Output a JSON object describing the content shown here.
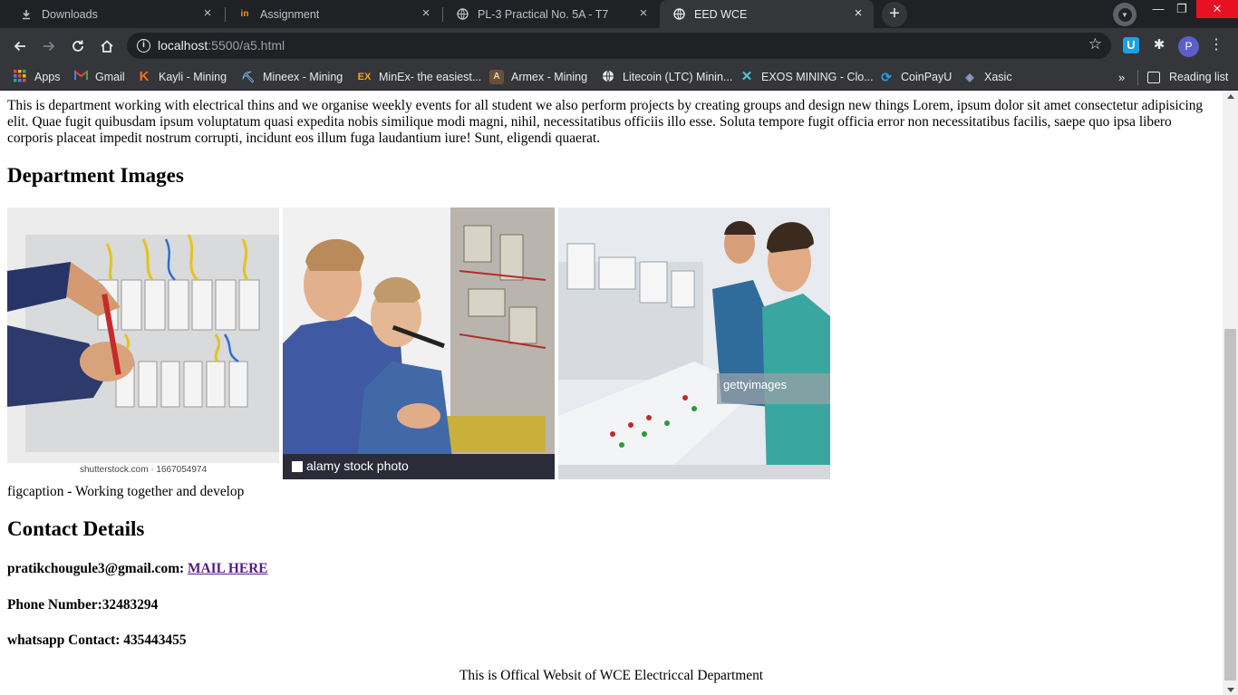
{
  "browser": {
    "tabs": [
      {
        "label": "Downloads",
        "icon": "download-icon"
      },
      {
        "label": "Assignment",
        "icon": "in-logo-icon"
      },
      {
        "label": "PL-3 Practical No. 5A - T7",
        "icon": "globe-icon"
      },
      {
        "label": "EED WCE",
        "icon": "globe-icon",
        "active": true
      }
    ],
    "new_tab_label": "+",
    "window_controls": {
      "minimize": "—",
      "restore": "❐",
      "close": "✕"
    },
    "address": {
      "host": "localhost",
      "path": ":5500/a5.html"
    },
    "profile_initial": "P",
    "extension_label": "U",
    "bookmarks": [
      {
        "label": "Apps",
        "icon": "apps-grid-icon"
      },
      {
        "label": "Gmail",
        "icon": "gmail-icon"
      },
      {
        "label": "Kayli - Mining",
        "icon": "k-logo-icon"
      },
      {
        "label": "Mineex - Mining",
        "icon": "mineex-icon"
      },
      {
        "label": "MinEx- the easiest...",
        "icon": "ex-logo-icon"
      },
      {
        "label": "Armex - Mining",
        "icon": "armex-icon"
      },
      {
        "label": "Litecoin (LTC) Minin...",
        "icon": "globe-icon"
      },
      {
        "label": "EXOS MINING - Clo...",
        "icon": "x-logo-icon"
      },
      {
        "label": "CoinPayU",
        "icon": "coinpayu-icon"
      },
      {
        "label": "Xasic",
        "icon": "xasic-icon"
      }
    ],
    "more_bookmarks": "»",
    "reading_list": "Reading list"
  },
  "page": {
    "intro": "This is department working with electrical thins and we organise weekly events for all student we also perform projects by creating groups and design new things Lorem, ipsum dolor sit amet consectetur adipisicing elit. Quae fugit quibusdam ipsum voluptatum quasi expedita nobis similique modi magni, nihil, necessitatibus officiis illo esse. Soluta tempore fugit officia error non necessitatibus facilis, saepe quo ipsa libero corporis placeat impedit nostrum corrupti, incidunt eos illum fuga laudantium iure! Sunt, eligendi quaerat.",
    "images_heading": "Department Images",
    "images": [
      {
        "watermark": "shutterstock.com · 1667054974"
      },
      {
        "watermark": "alamy stock photo"
      },
      {
        "watermark": "gettyimages"
      }
    ],
    "caption": "figcaption - Working together and develop",
    "contact_heading": "Contact Details",
    "email_label": "pratikchougule3@gmail.com:",
    "email_link": "MAIL HERE",
    "phone": "Phone Number:32483294",
    "whatsapp": "whatsapp Contact: 435443455",
    "footer": "This is Offical Websit of WCE Electriccal Department"
  },
  "colors": {
    "tabstrip": "#202124",
    "toolbar": "#35363a",
    "close_button": "#e81123",
    "visited_link": "#551a8b"
  }
}
